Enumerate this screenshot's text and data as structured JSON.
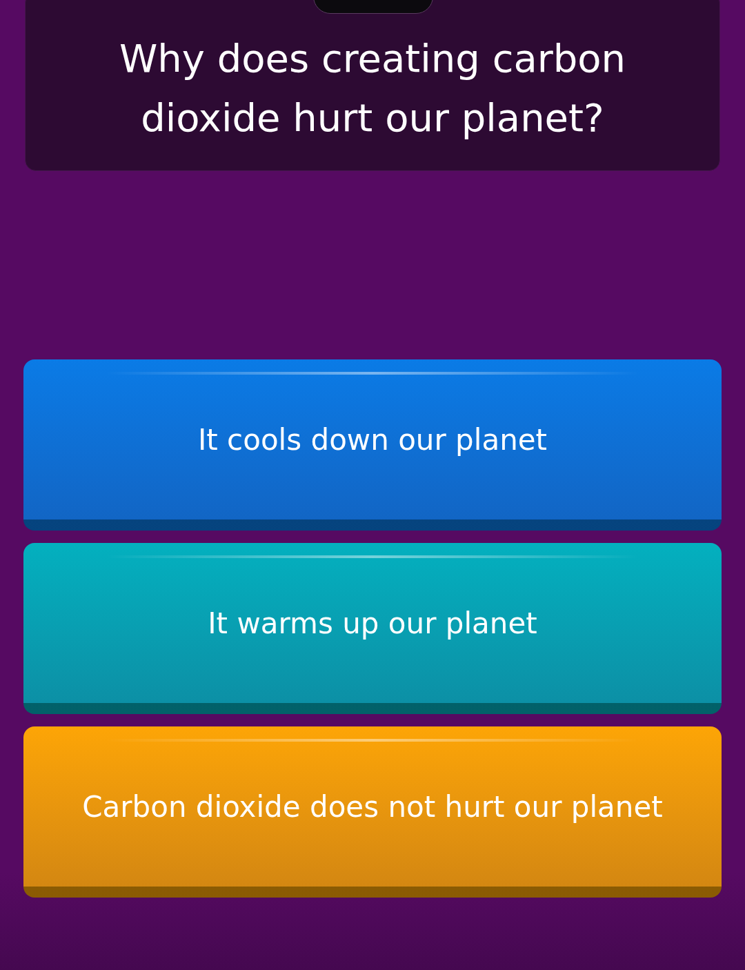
{
  "question": {
    "text": "Why does creating carbon dioxide hurt our planet?"
  },
  "answers": [
    {
      "text": "It cools down our planet",
      "color": "#0a7be6"
    },
    {
      "text": "It warms up our planet",
      "color": "#03b0bf"
    },
    {
      "text": "Carbon dioxide does not hurt our planet",
      "color": "#fda506"
    }
  ]
}
